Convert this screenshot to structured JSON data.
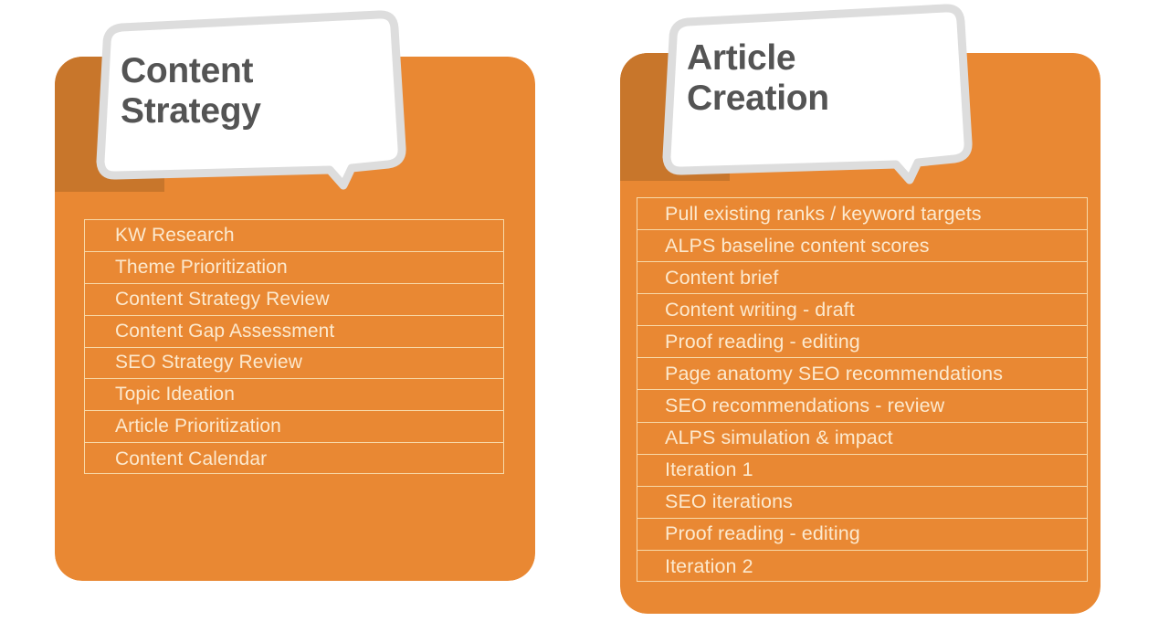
{
  "theme": {
    "card_orange": "#E98833",
    "card_orange_shadow": "#C8762B",
    "list_border": "#F8D9A8",
    "list_text": "#FCE9CE",
    "callout_fill": "#FFFFFF",
    "callout_border": "#DDDDDD",
    "callout_text": "#545454",
    "page_background": "#FFFFFF"
  },
  "panels": [
    {
      "id": "content-strategy",
      "title": "Content\nStrategy",
      "title_line1": "Content",
      "title_line2": "Strategy",
      "items": [
        "KW Research",
        "Theme Prioritization",
        "Content Strategy Review",
        "Content Gap Assessment",
        "SEO Strategy Review",
        "Topic Ideation",
        "Article Prioritization",
        "Content Calendar"
      ]
    },
    {
      "id": "article-creation",
      "title": "Article\nCreation",
      "title_line1": "Article",
      "title_line2": "Creation",
      "items": [
        "Pull existing ranks / keyword targets",
        "ALPS baseline content scores",
        "Content brief",
        "Content writing - draft",
        "Proof reading - editing",
        "Page anatomy SEO recommendations",
        "SEO recommendations - review",
        "ALPS simulation & impact",
        "Iteration 1",
        "SEO iterations",
        "Proof reading - editing",
        "Iteration 2"
      ]
    }
  ]
}
